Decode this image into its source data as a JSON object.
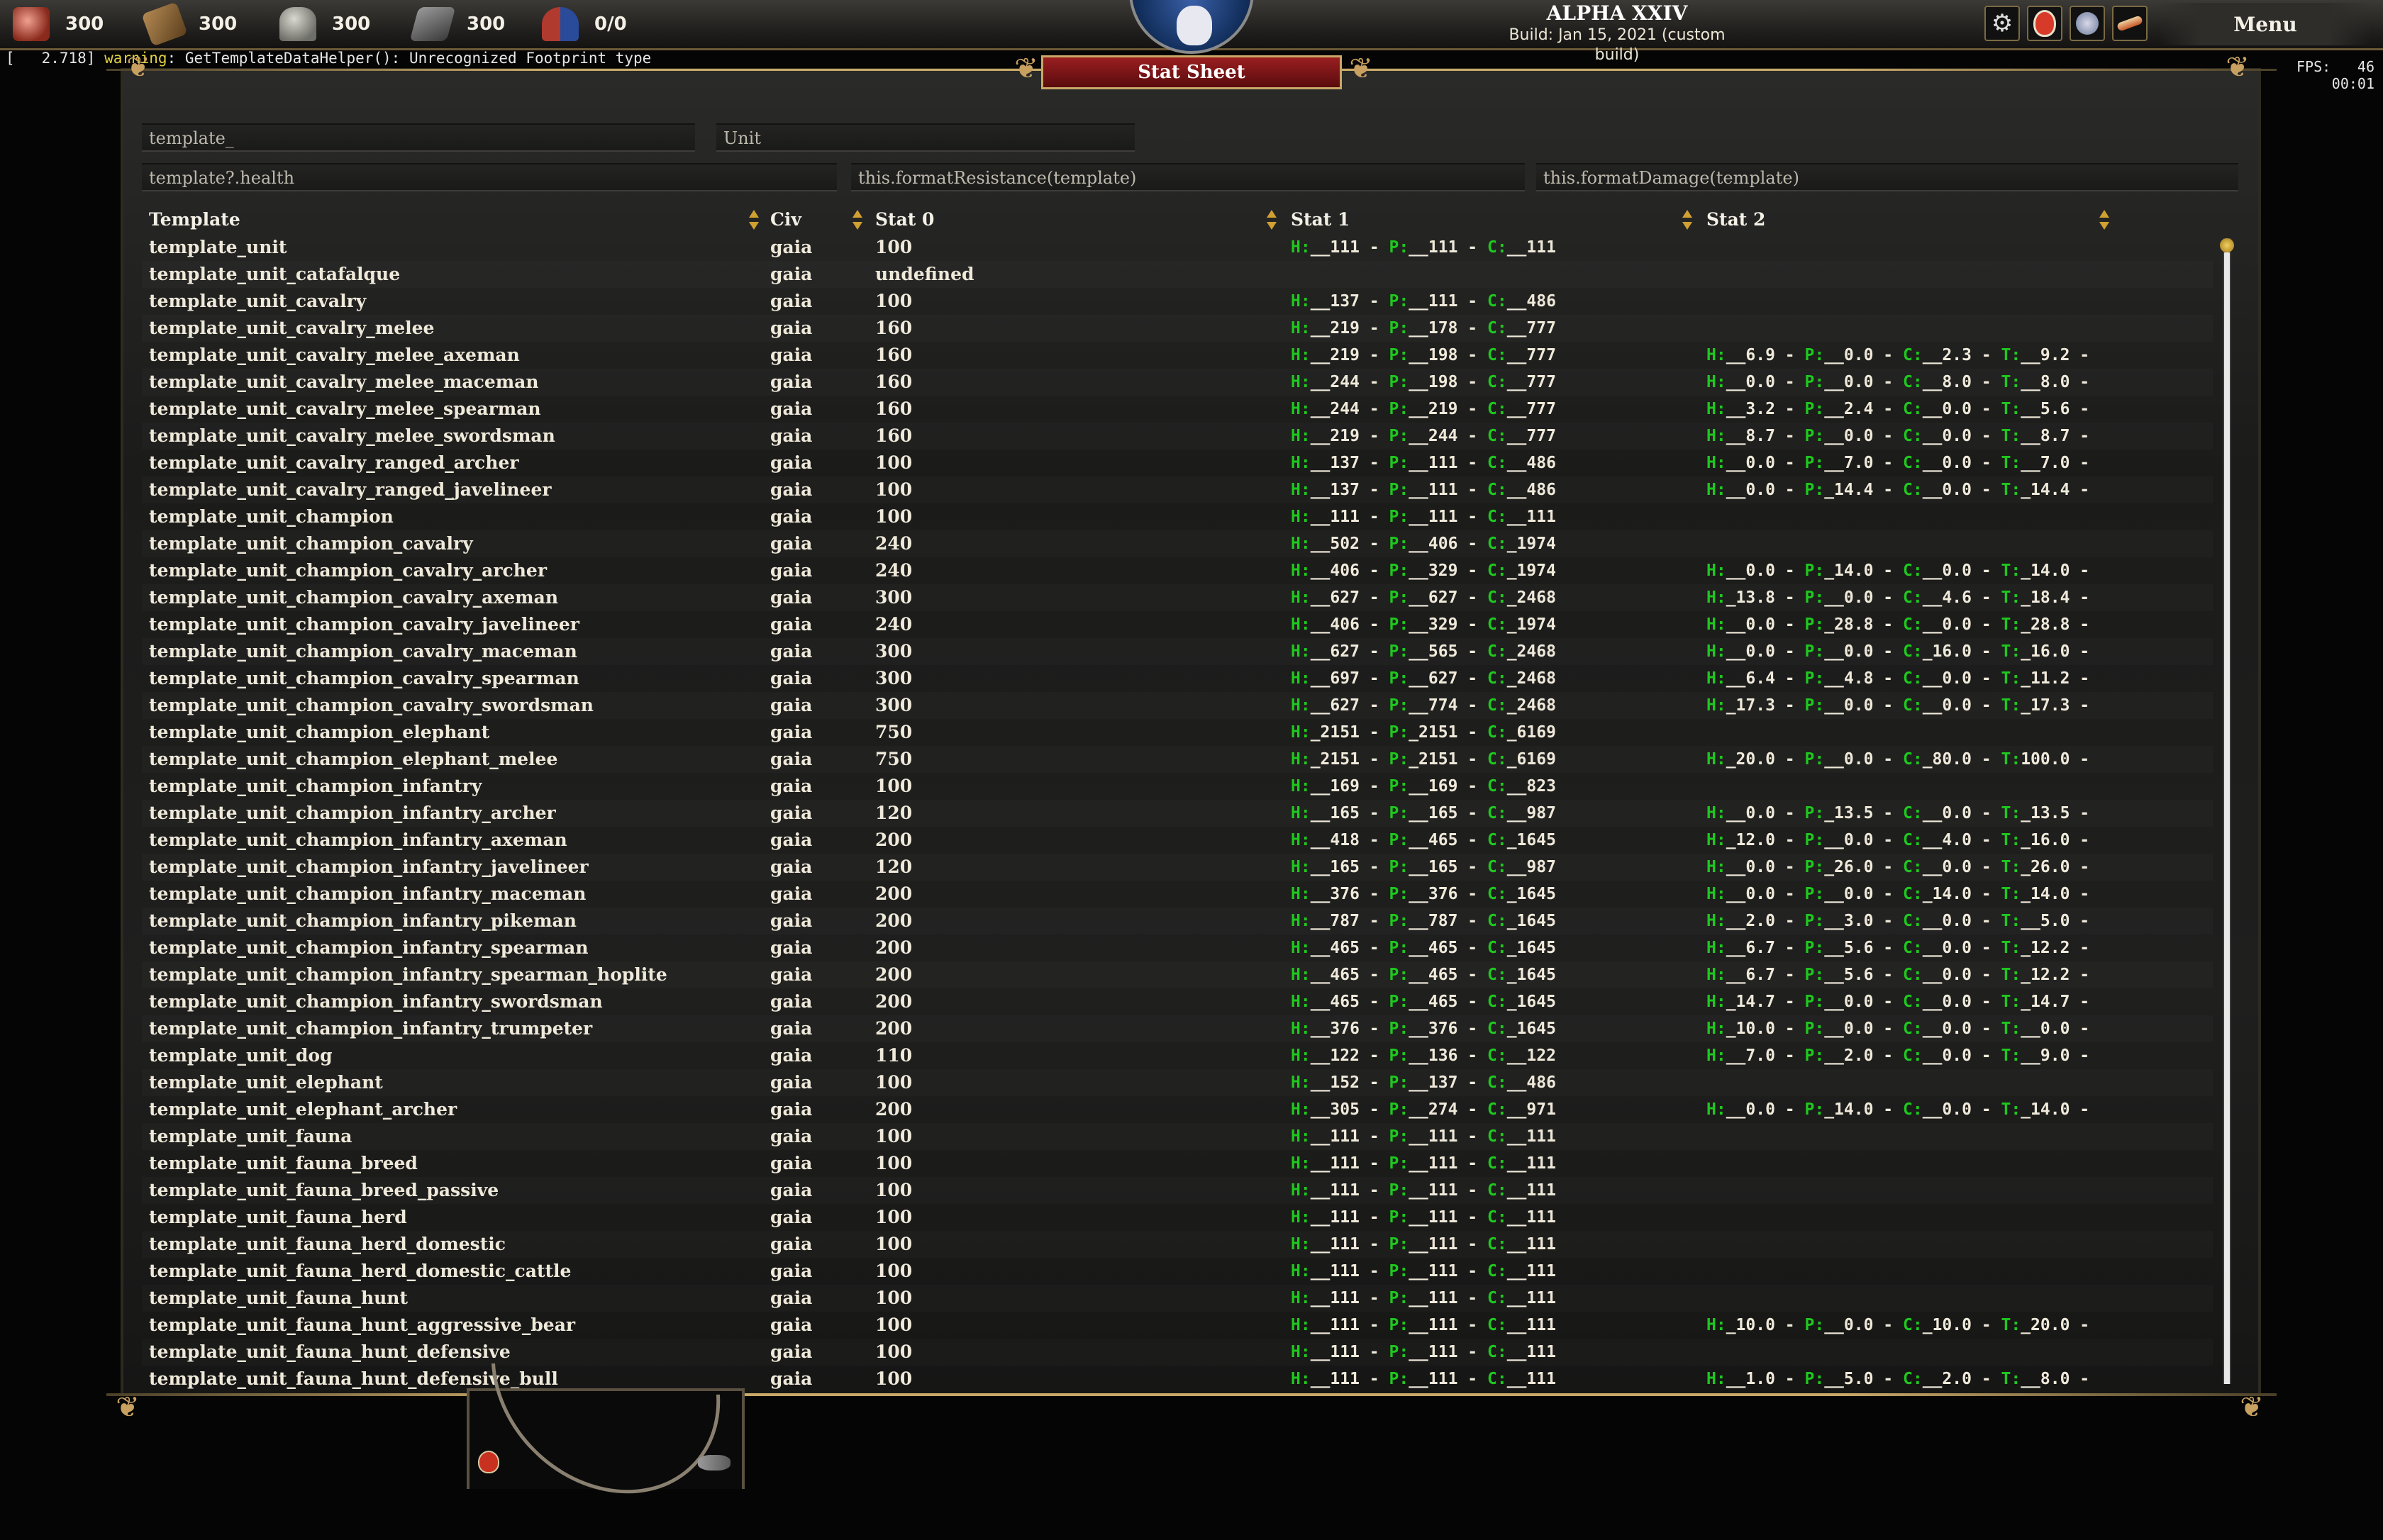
{
  "resources": [
    {
      "name": "food",
      "icon": "food-icon",
      "value": "300"
    },
    {
      "name": "wood",
      "icon": "wood-icon",
      "value": "300"
    },
    {
      "name": "stone",
      "icon": "stone-icon",
      "value": "300"
    },
    {
      "name": "metal",
      "icon": "metal-icon",
      "value": "300"
    },
    {
      "name": "population",
      "icon": "population-icon",
      "value": "0/0"
    }
  ],
  "header": {
    "game_title": "ALPHA XXIV",
    "build_info": "Build: Jan 15, 2021 (custom build)",
    "menu_label": "Menu"
  },
  "console": {
    "timestamp": "[   2.718] ",
    "level": "warning",
    "message": ": GetTemplateDataHelper(): Unrecognized Footprint type"
  },
  "fps": {
    "label": "FPS:",
    "value": "46",
    "time": "00:01"
  },
  "panel": {
    "title": "Stat Sheet"
  },
  "filters": {
    "template_filter": "template_",
    "type_filter": "Unit",
    "stat0_expr": "template?.health",
    "stat1_expr": "this.formatResistance(template)",
    "stat2_expr": "this.formatDamage(template)"
  },
  "columns": {
    "template": "Template",
    "civ": "Civ",
    "stat0": "Stat 0",
    "stat1": "Stat 1",
    "stat2": "Stat 2"
  },
  "colors": {
    "accent_green": "#1ec81e",
    "banner_red": "#9a1e20",
    "gold": "#c8a868"
  },
  "rows": [
    {
      "template": "template_unit",
      "civ": "gaia",
      "stat0": "100",
      "stat1": [
        "111",
        "111",
        "111"
      ],
      "stat2": null
    },
    {
      "template": "template_unit_catafalque",
      "civ": "gaia",
      "stat0": "undefined",
      "stat1": null,
      "stat2": null
    },
    {
      "template": "template_unit_cavalry",
      "civ": "gaia",
      "stat0": "100",
      "stat1": [
        "137",
        "111",
        "486"
      ],
      "stat2": null
    },
    {
      "template": "template_unit_cavalry_melee",
      "civ": "gaia",
      "stat0": "160",
      "stat1": [
        "219",
        "178",
        "777"
      ],
      "stat2": null
    },
    {
      "template": "template_unit_cavalry_melee_axeman",
      "civ": "gaia",
      "stat0": "160",
      "stat1": [
        "219",
        "198",
        "777"
      ],
      "stat2": [
        "6.9",
        "0.0",
        "2.3",
        "9.2"
      ]
    },
    {
      "template": "template_unit_cavalry_melee_maceman",
      "civ": "gaia",
      "stat0": "160",
      "stat1": [
        "244",
        "198",
        "777"
      ],
      "stat2": [
        "0.0",
        "0.0",
        "8.0",
        "8.0"
      ]
    },
    {
      "template": "template_unit_cavalry_melee_spearman",
      "civ": "gaia",
      "stat0": "160",
      "stat1": [
        "244",
        "219",
        "777"
      ],
      "stat2": [
        "3.2",
        "2.4",
        "0.0",
        "5.6"
      ]
    },
    {
      "template": "template_unit_cavalry_melee_swordsman",
      "civ": "gaia",
      "stat0": "160",
      "stat1": [
        "219",
        "244",
        "777"
      ],
      "stat2": [
        "8.7",
        "0.0",
        "0.0",
        "8.7"
      ]
    },
    {
      "template": "template_unit_cavalry_ranged_archer",
      "civ": "gaia",
      "stat0": "100",
      "stat1": [
        "137",
        "111",
        "486"
      ],
      "stat2": [
        "0.0",
        "7.0",
        "0.0",
        "7.0"
      ]
    },
    {
      "template": "template_unit_cavalry_ranged_javelineer",
      "civ": "gaia",
      "stat0": "100",
      "stat1": [
        "137",
        "111",
        "486"
      ],
      "stat2": [
        "0.0",
        "14.4",
        "0.0",
        "14.4"
      ]
    },
    {
      "template": "template_unit_champion",
      "civ": "gaia",
      "stat0": "100",
      "stat1": [
        "111",
        "111",
        "111"
      ],
      "stat2": null
    },
    {
      "template": "template_unit_champion_cavalry",
      "civ": "gaia",
      "stat0": "240",
      "stat1": [
        "502",
        "406",
        "1974"
      ],
      "stat2": null
    },
    {
      "template": "template_unit_champion_cavalry_archer",
      "civ": "gaia",
      "stat0": "240",
      "stat1": [
        "406",
        "329",
        "1974"
      ],
      "stat2": [
        "0.0",
        "14.0",
        "0.0",
        "14.0"
      ]
    },
    {
      "template": "template_unit_champion_cavalry_axeman",
      "civ": "gaia",
      "stat0": "300",
      "stat1": [
        "627",
        "627",
        "2468"
      ],
      "stat2": [
        "13.8",
        "0.0",
        "4.6",
        "18.4"
      ]
    },
    {
      "template": "template_unit_champion_cavalry_javelineer",
      "civ": "gaia",
      "stat0": "240",
      "stat1": [
        "406",
        "329",
        "1974"
      ],
      "stat2": [
        "0.0",
        "28.8",
        "0.0",
        "28.8"
      ]
    },
    {
      "template": "template_unit_champion_cavalry_maceman",
      "civ": "gaia",
      "stat0": "300",
      "stat1": [
        "627",
        "565",
        "2468"
      ],
      "stat2": [
        "0.0",
        "0.0",
        "16.0",
        "16.0"
      ]
    },
    {
      "template": "template_unit_champion_cavalry_spearman",
      "civ": "gaia",
      "stat0": "300",
      "stat1": [
        "697",
        "627",
        "2468"
      ],
      "stat2": [
        "6.4",
        "4.8",
        "0.0",
        "11.2"
      ]
    },
    {
      "template": "template_unit_champion_cavalry_swordsman",
      "civ": "gaia",
      "stat0": "300",
      "stat1": [
        "627",
        "774",
        "2468"
      ],
      "stat2": [
        "17.3",
        "0.0",
        "0.0",
        "17.3"
      ]
    },
    {
      "template": "template_unit_champion_elephant",
      "civ": "gaia",
      "stat0": "750",
      "stat1": [
        "2151",
        "2151",
        "6169"
      ],
      "stat2": null
    },
    {
      "template": "template_unit_champion_elephant_melee",
      "civ": "gaia",
      "stat0": "750",
      "stat1": [
        "2151",
        "2151",
        "6169"
      ],
      "stat2": [
        "20.0",
        "0.0",
        "80.0",
        "100.0"
      ]
    },
    {
      "template": "template_unit_champion_infantry",
      "civ": "gaia",
      "stat0": "100",
      "stat1": [
        "169",
        "169",
        "823"
      ],
      "stat2": null
    },
    {
      "template": "template_unit_champion_infantry_archer",
      "civ": "gaia",
      "stat0": "120",
      "stat1": [
        "165",
        "165",
        "987"
      ],
      "stat2": [
        "0.0",
        "13.5",
        "0.0",
        "13.5"
      ]
    },
    {
      "template": "template_unit_champion_infantry_axeman",
      "civ": "gaia",
      "stat0": "200",
      "stat1": [
        "418",
        "465",
        "1645"
      ],
      "stat2": [
        "12.0",
        "0.0",
        "4.0",
        "16.0"
      ]
    },
    {
      "template": "template_unit_champion_infantry_javelineer",
      "civ": "gaia",
      "stat0": "120",
      "stat1": [
        "165",
        "165",
        "987"
      ],
      "stat2": [
        "0.0",
        "26.0",
        "0.0",
        "26.0"
      ]
    },
    {
      "template": "template_unit_champion_infantry_maceman",
      "civ": "gaia",
      "stat0": "200",
      "stat1": [
        "376",
        "376",
        "1645"
      ],
      "stat2": [
        "0.0",
        "0.0",
        "14.0",
        "14.0"
      ]
    },
    {
      "template": "template_unit_champion_infantry_pikeman",
      "civ": "gaia",
      "stat0": "200",
      "stat1": [
        "787",
        "787",
        "1645"
      ],
      "stat2": [
        "2.0",
        "3.0",
        "0.0",
        "5.0"
      ]
    },
    {
      "template": "template_unit_champion_infantry_spearman",
      "civ": "gaia",
      "stat0": "200",
      "stat1": [
        "465",
        "465",
        "1645"
      ],
      "stat2": [
        "6.7",
        "5.6",
        "0.0",
        "12.2"
      ]
    },
    {
      "template": "template_unit_champion_infantry_spearman_hoplite",
      "civ": "gaia",
      "stat0": "200",
      "stat1": [
        "465",
        "465",
        "1645"
      ],
      "stat2": [
        "6.7",
        "5.6",
        "0.0",
        "12.2"
      ]
    },
    {
      "template": "template_unit_champion_infantry_swordsman",
      "civ": "gaia",
      "stat0": "200",
      "stat1": [
        "465",
        "465",
        "1645"
      ],
      "stat2": [
        "14.7",
        "0.0",
        "0.0",
        "14.7"
      ]
    },
    {
      "template": "template_unit_champion_infantry_trumpeter",
      "civ": "gaia",
      "stat0": "200",
      "stat1": [
        "376",
        "376",
        "1645"
      ],
      "stat2": [
        "10.0",
        "0.0",
        "0.0",
        "0.0"
      ]
    },
    {
      "template": "template_unit_dog",
      "civ": "gaia",
      "stat0": "110",
      "stat1": [
        "122",
        "136",
        "122"
      ],
      "stat2": [
        "7.0",
        "2.0",
        "0.0",
        "9.0"
      ]
    },
    {
      "template": "template_unit_elephant",
      "civ": "gaia",
      "stat0": "100",
      "stat1": [
        "152",
        "137",
        "486"
      ],
      "stat2": null
    },
    {
      "template": "template_unit_elephant_archer",
      "civ": "gaia",
      "stat0": "200",
      "stat1": [
        "305",
        "274",
        "971"
      ],
      "stat2": [
        "0.0",
        "14.0",
        "0.0",
        "14.0"
      ]
    },
    {
      "template": "template_unit_fauna",
      "civ": "gaia",
      "stat0": "100",
      "stat1": [
        "111",
        "111",
        "111"
      ],
      "stat2": null
    },
    {
      "template": "template_unit_fauna_breed",
      "civ": "gaia",
      "stat0": "100",
      "stat1": [
        "111",
        "111",
        "111"
      ],
      "stat2": null
    },
    {
      "template": "template_unit_fauna_breed_passive",
      "civ": "gaia",
      "stat0": "100",
      "stat1": [
        "111",
        "111",
        "111"
      ],
      "stat2": null
    },
    {
      "template": "template_unit_fauna_herd",
      "civ": "gaia",
      "stat0": "100",
      "stat1": [
        "111",
        "111",
        "111"
      ],
      "stat2": null
    },
    {
      "template": "template_unit_fauna_herd_domestic",
      "civ": "gaia",
      "stat0": "100",
      "stat1": [
        "111",
        "111",
        "111"
      ],
      "stat2": null
    },
    {
      "template": "template_unit_fauna_herd_domestic_cattle",
      "civ": "gaia",
      "stat0": "100",
      "stat1": [
        "111",
        "111",
        "111"
      ],
      "stat2": null
    },
    {
      "template": "template_unit_fauna_hunt",
      "civ": "gaia",
      "stat0": "100",
      "stat1": [
        "111",
        "111",
        "111"
      ],
      "stat2": null
    },
    {
      "template": "template_unit_fauna_hunt_aggressive_bear",
      "civ": "gaia",
      "stat0": "100",
      "stat1": [
        "111",
        "111",
        "111"
      ],
      "stat2": [
        "10.0",
        "0.0",
        "10.0",
        "20.0"
      ]
    },
    {
      "template": "template_unit_fauna_hunt_defensive",
      "civ": "gaia",
      "stat0": "100",
      "stat1": [
        "111",
        "111",
        "111"
      ],
      "stat2": null
    },
    {
      "template": "template_unit_fauna_hunt_defensive_bull",
      "civ": "gaia",
      "stat0": "100",
      "stat1": [
        "111",
        "111",
        "111"
      ],
      "stat2": [
        "1.0",
        "5.0",
        "2.0",
        "8.0"
      ]
    }
  ]
}
